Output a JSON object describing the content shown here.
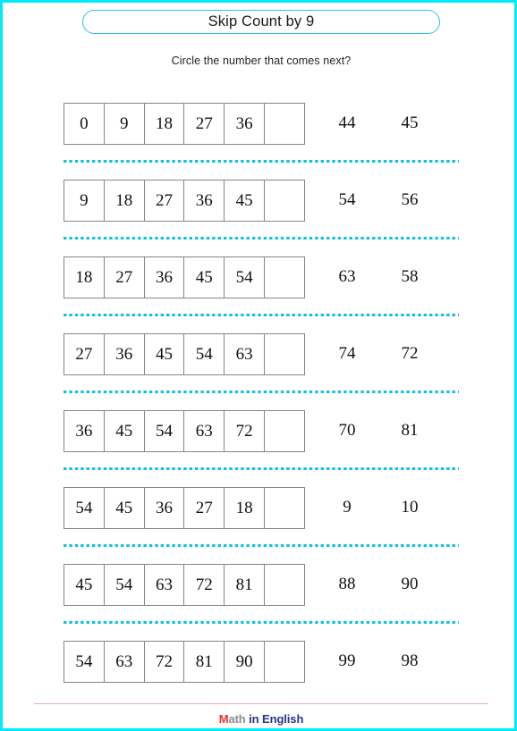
{
  "page": {
    "border_color": "#00e9ff",
    "background": "#ffffff"
  },
  "header": {
    "title": "Skip Count by 9",
    "pill_border_color": "#2ec2e6",
    "subtitle": "Circle the number that comes next?"
  },
  "worksheet": {
    "separator_color": "#10c0e8",
    "cell_border_color": "#868686",
    "rows": [
      {
        "sequence": [
          "0",
          "9",
          "18",
          "27",
          "36",
          ""
        ],
        "choices": [
          "44",
          "45"
        ]
      },
      {
        "sequence": [
          "9",
          "18",
          "27",
          "36",
          "45",
          ""
        ],
        "choices": [
          "54",
          "56"
        ]
      },
      {
        "sequence": [
          "18",
          "27",
          "36",
          "45",
          "54",
          ""
        ],
        "choices": [
          "63",
          "58"
        ]
      },
      {
        "sequence": [
          "27",
          "36",
          "45",
          "54",
          "63",
          ""
        ],
        "choices": [
          "74",
          "72"
        ]
      },
      {
        "sequence": [
          "36",
          "45",
          "54",
          "63",
          "72",
          ""
        ],
        "choices": [
          "70",
          "81"
        ]
      },
      {
        "sequence": [
          "54",
          "45",
          "36",
          "27",
          "18",
          ""
        ],
        "choices": [
          "9",
          "10"
        ]
      },
      {
        "sequence": [
          "45",
          "54",
          "63",
          "72",
          "81",
          ""
        ],
        "choices": [
          "88",
          "90"
        ]
      },
      {
        "sequence": [
          "54",
          "63",
          "72",
          "81",
          "90",
          ""
        ],
        "choices": [
          "99",
          "98"
        ]
      }
    ]
  },
  "footer": {
    "rule_color": "#eda7c4",
    "logo_m": "M",
    "logo_ath": "ath",
    "logo_rest": " in English"
  }
}
